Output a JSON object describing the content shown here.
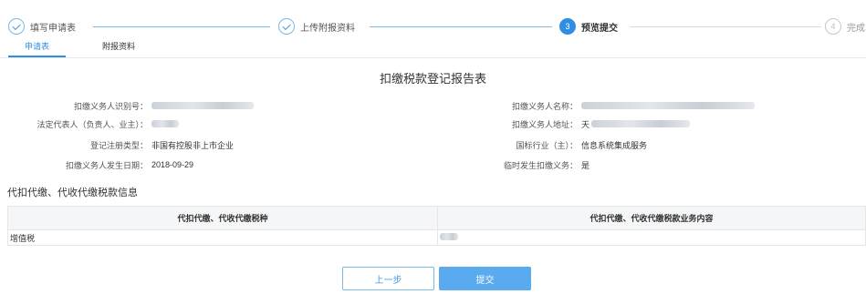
{
  "steps": [
    {
      "label": "填写申请表",
      "number": "",
      "status": "done",
      "icon": "check-icon"
    },
    {
      "label": "上传附报资料",
      "number": "",
      "status": "done",
      "icon": "check-icon"
    },
    {
      "label": "预览提交",
      "number": "3",
      "status": "active",
      "icon": ""
    },
    {
      "label": "完成",
      "number": "4",
      "status": "todo",
      "icon": ""
    }
  ],
  "tabs": [
    {
      "label": "申请表",
      "active": true
    },
    {
      "label": "附报资料",
      "active": false
    }
  ],
  "form": {
    "title": "扣缴税款登记报告表",
    "left": [
      {
        "label": "扣缴义务人识别号：",
        "value": ""
      },
      {
        "label": "法定代表人（负责人、业主）：",
        "value": ""
      },
      {
        "label": "登记注册类型：",
        "value": "非国有控股非上市企业"
      },
      {
        "label": "扣缴义务人发生日期：",
        "value": "2018-09-29"
      }
    ],
    "right": [
      {
        "label": "扣缴义务人名称：",
        "value": ""
      },
      {
        "label": "扣缴义务人地址：",
        "value": "天"
      },
      {
        "label": "国标行业（主）：",
        "value": "信息系统集成服务"
      },
      {
        "label": "临时发生扣缴义务：",
        "value": "是"
      }
    ]
  },
  "section": {
    "title": "代扣代缴、代收代缴税款信息"
  },
  "table": {
    "headers": [
      "代扣代缴、代收代缴税种",
      "代扣代缴、代收代缴税款业务内容"
    ],
    "rows": [
      [
        "增值税",
        ""
      ]
    ]
  },
  "buttons": {
    "prev": "上一步",
    "submit": "提交"
  },
  "colors": {
    "accent": "#2f8ee4",
    "submit_bg": "#5aaaf0"
  }
}
